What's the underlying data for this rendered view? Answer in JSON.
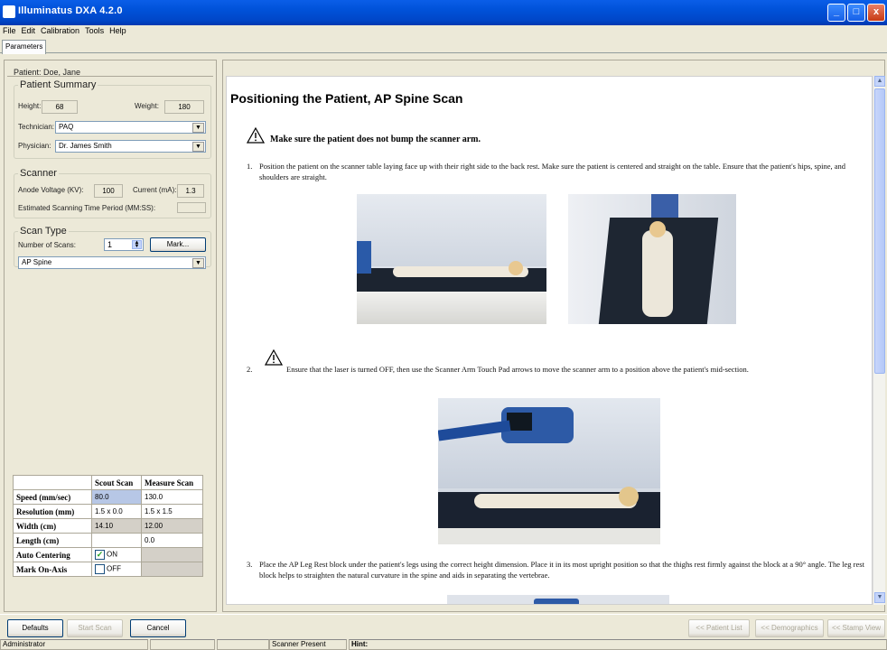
{
  "window": {
    "title": "Illuminatus DXA 4.2.0",
    "min": "_",
    "max": "□",
    "close": "x"
  },
  "menu": [
    "File",
    "Edit",
    "Calibration",
    "Tools",
    "Help"
  ],
  "tabs": [
    "Parameters"
  ],
  "patient": {
    "header": "Patient: Doe, Jane",
    "summary_title": "Patient Summary",
    "height_label": "Height:",
    "height_value": "68",
    "weight_label": "Weight:",
    "weight_value": "180",
    "technician_label": "Technician:",
    "technician_value": "PAQ",
    "physician_label": "Physician:",
    "physician_value": "Dr. James Smith"
  },
  "scanner": {
    "title": "Scanner",
    "anode_label": "Anode Voltage (KV):",
    "anode_value": "100",
    "current_label": "Current (mA):",
    "current_value": "1.3",
    "time_label": "Estimated Scanning Time Period (MM:SS):",
    "time_value": ""
  },
  "scan_type": {
    "title": "Scan Type",
    "num_label": "Number of Scans:",
    "num_value": "1",
    "mark_label": "Mark...",
    "type_value": "AP Spine"
  },
  "scan_table": {
    "col_headers": [
      "",
      "Scout Scan",
      "Measure Scan"
    ],
    "rows": [
      {
        "label": "Speed (mm/sec)",
        "scout": "80.0",
        "measure": "130.0"
      },
      {
        "label": "Resolution (mm)",
        "scout": "1.5 x 0.0",
        "measure": "1.5 x 1.5"
      },
      {
        "label": "Width (cm)",
        "scout": "14.10",
        "measure": "12.00"
      },
      {
        "label": "Length (cm)",
        "scout": "",
        "measure": "0.0"
      },
      {
        "label": "Auto Centering",
        "scout": "ON",
        "measure": ""
      },
      {
        "label": "Mark On-Axis",
        "scout": "OFF",
        "measure": ""
      }
    ]
  },
  "doc": {
    "title": "Positioning the Patient, AP Spine Scan",
    "warning": "Make sure the patient does not bump the scanner arm.",
    "step1_num": "1.",
    "step1": "Position the patient on the scanner table laying face up with their right side to the back rest. Make sure the patient is centered and straight on the table. Ensure that the patient's hips, spine, and shoulders are straight.",
    "step2_num": "2.",
    "step2": "Ensure that the laser is turned OFF, then use the Scanner Arm Touch Pad arrows to move the scanner arm to a position above the patient's mid-section.",
    "step3_num": "3.",
    "step3": "Place the AP Leg Rest block under the patient's legs using the correct height dimension. Place it in its most upright position so that the thighs rest firmly against the block at a 90° angle. The leg rest block helps to straighten the natural curvature in the spine and aids in separating the vertebrae."
  },
  "buttons": {
    "defaults": "Defaults",
    "start_scan": "Start Scan",
    "cancel": "Cancel",
    "patient_list": "<< Patient List",
    "demographics": "<< Demographics",
    "stamp_view": "<< Stamp View"
  },
  "status": {
    "user": "Administrator",
    "scanner": "Scanner Present",
    "hint": "Hint:"
  },
  "icons": [
    "app-icon",
    "warning-icon",
    "spinner-icon",
    "dropdown-arrow-icon",
    "check-icon",
    "scroll-up-icon",
    "scroll-down-icon"
  ]
}
